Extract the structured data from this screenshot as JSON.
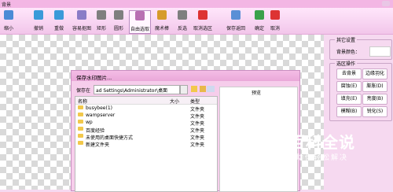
{
  "window": {
    "title": "背景"
  },
  "toolbar": {
    "items": [
      {
        "label": "缩小",
        "icon": "zoom-out-icon",
        "color": "#4b8bd6"
      },
      {
        "label": "撤销",
        "icon": "undo-icon",
        "color": "#3a9ad9"
      },
      {
        "label": "重做",
        "icon": "redo-icon",
        "color": "#3a9ad9"
      },
      {
        "label": "容易抠图",
        "icon": "easy-cutout-icon",
        "color": "#8a7cc7"
      },
      {
        "label": "矩形",
        "icon": "rectangle-select-icon",
        "color": "#7f7f7f"
      },
      {
        "label": "圆形",
        "icon": "circle-select-icon",
        "color": "#7f7f7f"
      },
      {
        "label": "自由选取",
        "icon": "lasso-icon",
        "color": "#b86fb2"
      },
      {
        "label": "魔术棒",
        "icon": "magic-wand-icon",
        "color": "#d69b2b"
      },
      {
        "label": "反选",
        "icon": "invert-select-icon",
        "color": "#7f7f7f"
      },
      {
        "label": "取消选区",
        "icon": "clear-selection-icon",
        "color": "#d33"
      },
      {
        "label": "保存返回",
        "icon": "save-return-icon",
        "color": "#5a8fd6"
      },
      {
        "label": "确定",
        "icon": "confirm-icon",
        "color": "#3aa14a"
      },
      {
        "label": "取消",
        "icon": "cancel-icon",
        "color": "#d33"
      }
    ]
  },
  "right_panel": {
    "other_settings": {
      "title": "其它设置",
      "bg_color_label": "背景颜色："
    },
    "selection_ops": {
      "title": "选区操作",
      "buttons": [
        "去背景",
        "边缘羽化",
        "腐蚀(E)",
        "膨胀(D)",
        "填充(E)",
        "亮度(B)",
        "模糊(B)",
        "锐化(S)"
      ]
    }
  },
  "dialog": {
    "title": "保存水印图片...",
    "save_in_label": "保存在",
    "path": "ad Settings\\Administrator\\桌面",
    "columns": {
      "name": "名称",
      "size": "大小",
      "type": "类型"
    },
    "files": [
      {
        "name": "busybee(1)",
        "type": "文件夹"
      },
      {
        "name": "wampserver",
        "type": "文件夹"
      },
      {
        "name": "wp",
        "type": "文件夹"
      },
      {
        "name": "百度经验",
        "type": "文件夹"
      },
      {
        "name": "未使用的桌面快捷方式",
        "type": "文件夹"
      },
      {
        "name": "新建文件夹",
        "type": "文件夹"
      }
    ],
    "preview_label": "预览"
  },
  "watermark": {
    "line1": "百科全说",
    "line2": "助你轻松解决"
  }
}
